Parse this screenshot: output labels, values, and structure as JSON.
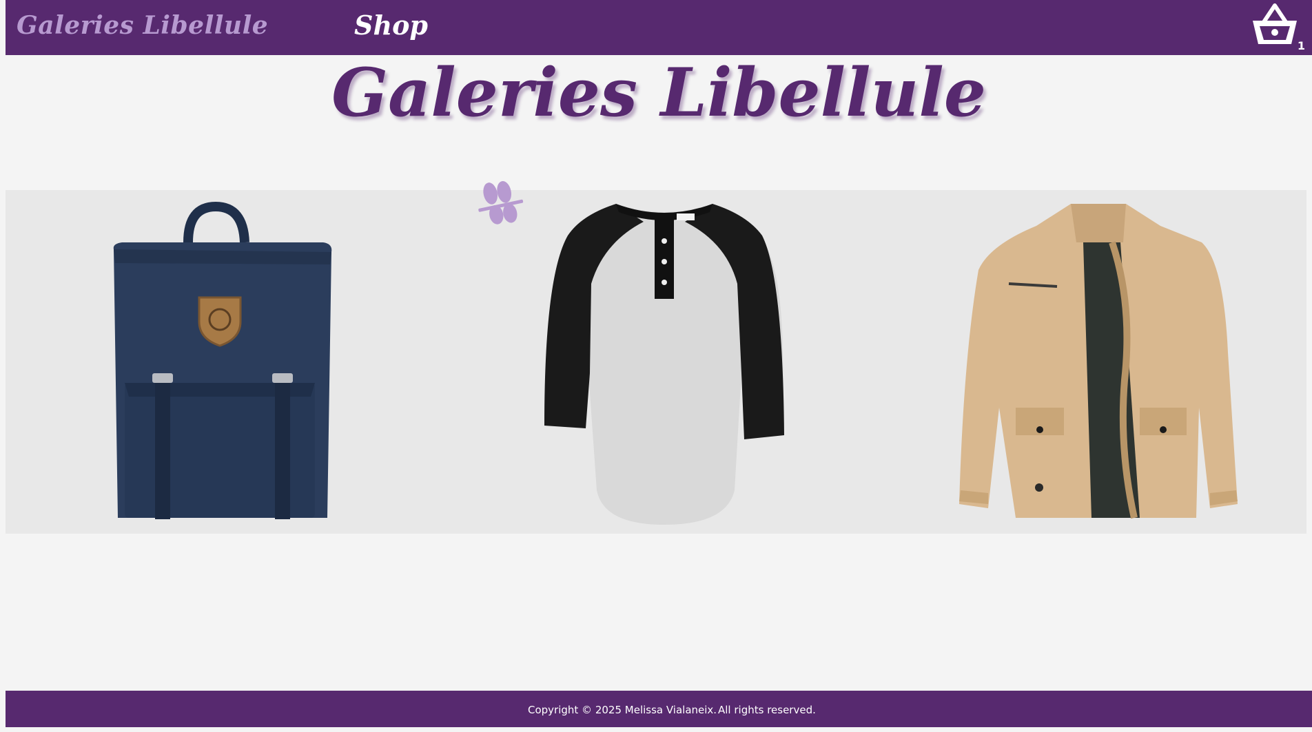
{
  "header": {
    "brand": "Galeries Libellule",
    "nav_shop": "Shop",
    "cart_count": "1"
  },
  "hero": {
    "title": "Galeries Libellule"
  },
  "products": [
    {
      "icon": "backpack-image"
    },
    {
      "icon": "raglan-henley-shirt-image"
    },
    {
      "icon": "khaki-jacket-image"
    }
  ],
  "footer": {
    "copyright": "Copyright © 2025 Melissa Vialaneix.",
    "rights": "All rights reserved."
  },
  "colors": {
    "brand_purple": "#57296f",
    "brand_light_purple": "#b79ad0",
    "background": "#f4f4f4",
    "gallery_background": "#e8e8e8"
  }
}
